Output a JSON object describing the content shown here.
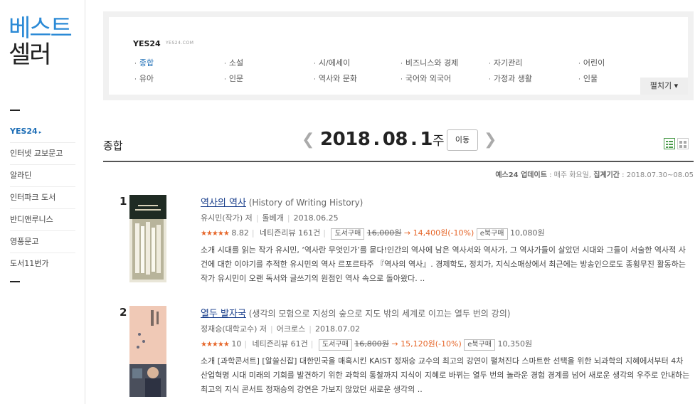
{
  "sidebar": {
    "brand_line1": "베스트",
    "brand_line2": "셀러",
    "items": [
      {
        "label": "YES24",
        "arrow": "▸"
      },
      {
        "label": "인터넷 교보문고"
      },
      {
        "label": "알라딘"
      },
      {
        "label": "인터파크 도서"
      },
      {
        "label": "반디앤루니스"
      },
      {
        "label": "영풍문고"
      },
      {
        "label": "도서11번가"
      }
    ]
  },
  "category_box": {
    "logo": "YES24",
    "logo_sub": "YES24.COM",
    "categories": [
      {
        "label": "종합"
      },
      {
        "label": "소설"
      },
      {
        "label": "시/에세이"
      },
      {
        "label": "비즈니스와 경제"
      },
      {
        "label": "자기관리"
      },
      {
        "label": "어린이"
      },
      {
        "label": "유아"
      },
      {
        "label": "인문"
      },
      {
        "label": "역사와 문화"
      },
      {
        "label": "국어와 외국어"
      },
      {
        "label": "가정과 생활"
      },
      {
        "label": "인물"
      }
    ],
    "expand_label": "펼치기 ▾"
  },
  "heading": {
    "section_title": "종합",
    "year": "2018",
    "month": "08",
    "week": "1",
    "week_suffix": "주",
    "move_label": "이동",
    "update_label": "예스24 업데이트",
    "update_value": " : 매주 화요일, ",
    "period_label": "집계기간",
    "period_value": " : 2018.07.30~08.05"
  },
  "books": [
    {
      "rank": "1",
      "title": "역사의 역사",
      "subtitle": " (History of Writing History)",
      "author": "유시민(작가) 저",
      "publisher": "돌베개",
      "date": "2018.06.25",
      "stars": "★★★★★",
      "rating": "8.82",
      "reviews": "네티즌리뷰 161건",
      "buy_label": "도서구매",
      "orig_price": "16,000원",
      "arrow": "→",
      "sale_price": "14,400원(-10%)",
      "ebook_label": "e북구매",
      "ebook_price": "10,080원",
      "description": "소개 시대를 읽는 작가 유시민, ‘역사란 무엇인가’를 묻다!인간의 역사에 남은 역사서와 역사가, 그 역사가들이 살았던 시대와 그들이 서술한 역사적 사건에 대한 이야기를 추적한 유시민의 역사 르포르타주 『역사의 역사』. 경제학도, 정치가, 지식소매상에서 최근에는 방송인으로도 종횡무진 활동하는 작가 유시민이 오랜 독서와 글쓰기의 원점인 역사 속으로 돌아왔다. ..",
      "cover_bg": "#8f9a7b",
      "cover_top": "#2c3a30"
    },
    {
      "rank": "2",
      "title": "열두 발자국",
      "subtitle": " (생각의 모험으로 지성의 숲으로 지도 밖의 세계로 이끄는 열두 번의 강의)",
      "author": "정재승(대학교수) 저",
      "publisher": "어크로스",
      "date": "2018.07.02",
      "stars": "★★★★★",
      "rating": "10",
      "reviews": "네티즌리뷰 61건",
      "buy_label": "도서구매",
      "orig_price": "16,800원",
      "arrow": "→",
      "sale_price": "15,120원(-10%)",
      "ebook_label": "e북구매",
      "ebook_price": "10,350원",
      "description": "소개 [과학콘서트] [알쓸신잡] 대한민국을 매혹시킨 KAIST 정재승 교수의 최고의 강연이 펼쳐진다 스마트한 선택을 위한 뇌과학의 지혜에서부터 4차 산업혁명 시대 미래의 기회를 발견하기 위한 과학의 통찰까지 지식이 지혜로 바뀌는 열두 번의 놀라운 경험 경계를 넘어 새로운 생각의 우주로 안내하는 최고의 지식 콘서트 정재승의 강연은 가보지 않았던 새로운 생각의 ..",
      "cover_bg": "#f0c9b6",
      "cover_top": "#f3d3c3"
    }
  ],
  "colors": {
    "accent_blue": "#1f6fb7",
    "brand_blue": "#2b8ad6",
    "sale_orange": "#e6672b",
    "title_link": "#1a3f8c"
  }
}
